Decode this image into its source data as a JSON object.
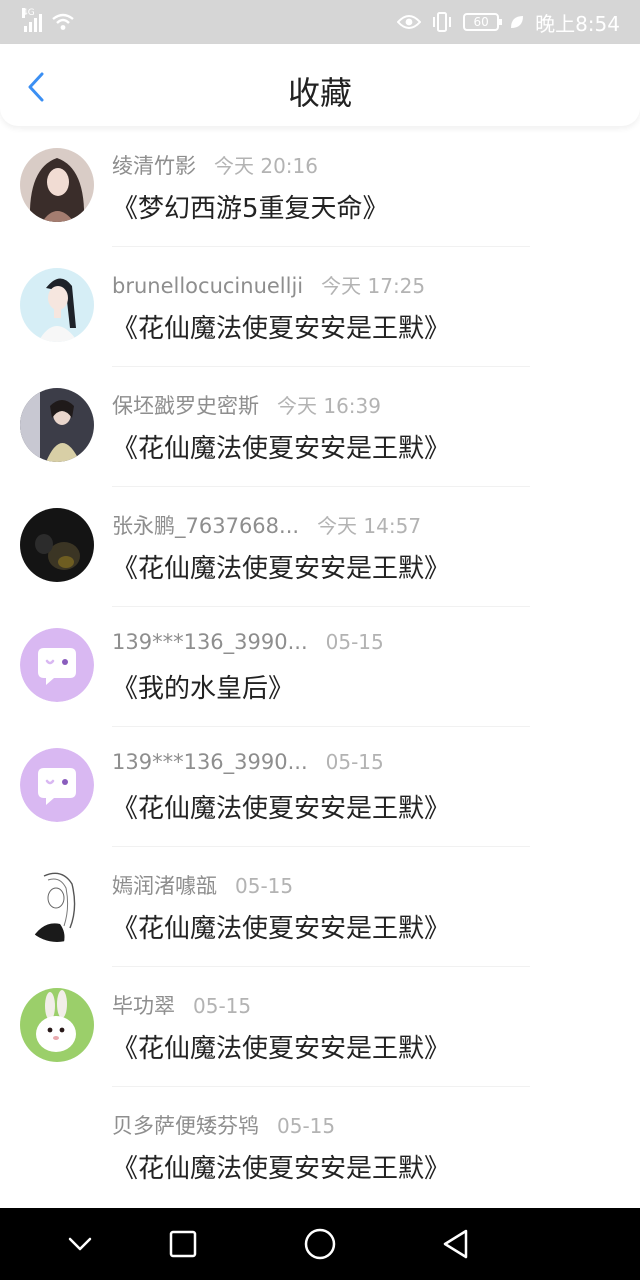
{
  "status_bar": {
    "network_type": "4G",
    "battery_level": "60",
    "time": "晚上8:54"
  },
  "header": {
    "title": "收藏"
  },
  "favorites": [
    {
      "user": "绫清竹影",
      "time": "今天 20:16",
      "book": "《梦幻西游5重复天命》",
      "avatar": "avatar-anime-girl-dark-hair"
    },
    {
      "user": "brunellocucinuellji",
      "time": "今天 17:25",
      "book": "《花仙魔法使夏安安是王默》",
      "avatar": "avatar-girl-ponytail-blue-bg"
    },
    {
      "user": "保坯戤罗史密斯",
      "time": "今天 16:39",
      "book": "《花仙魔法使夏安安是王默》",
      "avatar": "avatar-photo-girls"
    },
    {
      "user": "张永鹏_7637668...",
      "time": "今天 14:57",
      "book": "《花仙魔法使夏安安是王默》",
      "avatar": "avatar-dark-photo"
    },
    {
      "user": "139***136_3990...",
      "time": "05-15",
      "book": "《我的水皇后》",
      "avatar": "avatar-default-chat-bubble"
    },
    {
      "user": "139***136_3990...",
      "time": "05-15",
      "book": "《花仙魔法使夏安安是王默》",
      "avatar": "avatar-default-chat-bubble"
    },
    {
      "user": "嫣润渚噱瓿",
      "time": "05-15",
      "book": "《花仙魔法使夏安安是王默》",
      "avatar": "avatar-sketch-girl"
    },
    {
      "user": "毕功翠",
      "time": "05-15",
      "book": "《花仙魔法使夏安安是王默》",
      "avatar": "avatar-white-rabbit"
    },
    {
      "user": "贝多萨便矮芬鸨",
      "time": "05-15",
      "book": "《花仙魔法使夏安安是王默》",
      "avatar": "avatar-none"
    }
  ],
  "colors": {
    "accent": "#3b8ff3",
    "default_avatar": "#d9b8f2"
  }
}
